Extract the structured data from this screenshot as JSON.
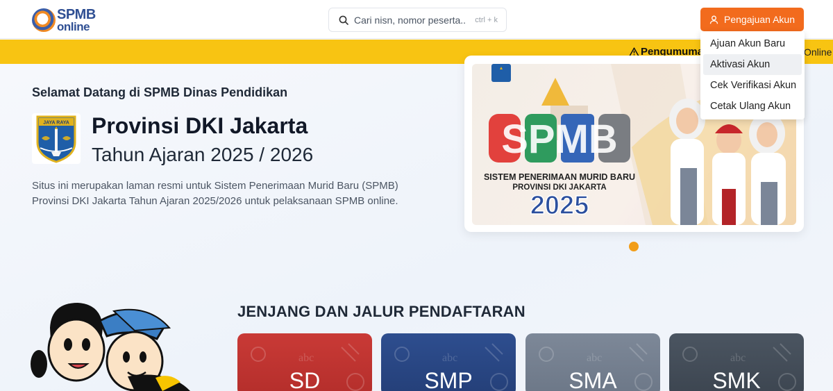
{
  "header": {
    "logo_title": "SPMB",
    "logo_sub": "online",
    "search_placeholder": "Cari nisn, nomor peserta...",
    "search_shortcut": "ctrl + k",
    "account_button": "Pengajuan Akun"
  },
  "announcement": {
    "title": "Pengumuma",
    "tail": "Online"
  },
  "dropdown": {
    "items": [
      {
        "label": "Ajuan Akun Baru"
      },
      {
        "label": "Aktivasi Akun"
      },
      {
        "label": "Cek Verifikasi Akun"
      },
      {
        "label": "Cetak Ulang Akun"
      }
    ],
    "active_index": 1
  },
  "hero": {
    "welcome": "Selamat Datang di SPMB Dinas Pendidikan",
    "emblem_motto": "JAYA RAYA",
    "province": "Provinsi DKI Jakarta",
    "year": "Tahun Ajaran 2025 / 2026",
    "description": "Situs ini merupakan laman resmi untuk Sistem Penerimaan Murid Baru (SPMB) Provinsi DKI Jakarta Tahun Ajaran 2025/2026 untuk pelaksanaan SPMB online."
  },
  "banner": {
    "logo_text": "SPMB",
    "line1": "SISTEM PENERIMAAN MURID BARU",
    "line2": "PROVINSI DKI JAKARTA",
    "year": "2025"
  },
  "section": {
    "title": "JENJANG DAN JALUR PENDAFTARAN",
    "levels": [
      {
        "label": "SD",
        "color": "#c23431"
      },
      {
        "label": "SMP",
        "color": "#2a4785"
      },
      {
        "label": "SMA",
        "color": "#768192"
      },
      {
        "label": "SMK",
        "color": "#444e59"
      }
    ]
  },
  "colors": {
    "accent": "#f26b1d",
    "announcement_bar": "#f8c412",
    "brand_blue": "#2f4f93",
    "carousel_dot": "#f29d18"
  }
}
